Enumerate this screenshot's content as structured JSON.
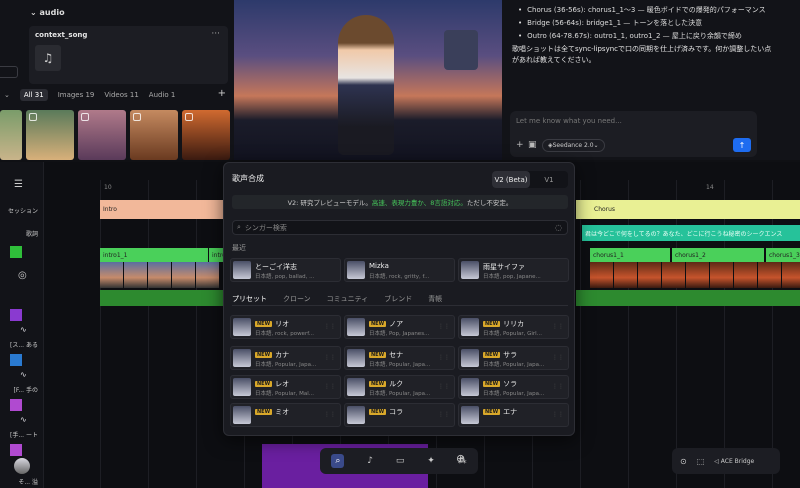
{
  "media_panel": {
    "section": "audio",
    "card_title": "context_song",
    "card_menu": "···",
    "filters": [
      "All 31",
      "Images 19",
      "Videos 11",
      "Audio 1"
    ],
    "add": "+"
  },
  "chat": {
    "bullets": [
      "Chorus (36-56s): chorus1_1〜3 — 暖色ボイドでの爆発的パフォーマンス",
      "Bridge (56-64s): bridge1_1 — トーンを落とした決意",
      "Outro (64-78.67s): outro1_1, outro1_2 — 屋上に戻り余韻で締め"
    ],
    "paragraph": "歌唱ショットは全てsync-lipsyncで口の同期を仕上げ済みです。何か調整したい点があれば教えてください。",
    "placeholder": "Let me know what you need...",
    "model": "Seedance 2.0",
    "send": "↑"
  },
  "timeline": {
    "row_labels": [
      "セッション",
      "歌詞"
    ],
    "section_intro": "Intro",
    "section_chorus": "Chorus",
    "lyric_text": "君は今どこで何をしてるの？あなた、どこに行こうね秘密のシークエンス",
    "clip_labels": [
      "intro1_1",
      "intro1_1",
      "chorus1_1",
      "chorus1_2",
      "chorus1_3"
    ],
    "side_items": [
      "[ス... ある",
      "[F... 手の",
      "[手... ート",
      "そ... 溢"
    ],
    "ruler_ticks": [
      "10",
      "14"
    ]
  },
  "modal": {
    "title": "歌声合成",
    "version_on": "V2 (Beta)",
    "version_off": "V1",
    "banner_pre": "V2: 研究プレビューモデル。",
    "banner_green": "高速、表現力豊か、8言語対応。",
    "banner_post": "ただし不安定。",
    "search_placeholder": "シンガー検索",
    "recent_label": "最近",
    "recent": [
      {
        "name": "とーごイ洋志",
        "tags": "日本語, pop, ballad, ..."
      },
      {
        "name": "Mizka",
        "tags": "日本語, rock, gritty, f..."
      },
      {
        "name": "雨星サイファ",
        "tags": "日本語, pop, Japane..."
      }
    ],
    "tabs": [
      "プリセット",
      "クローン",
      "コミュニティ",
      "ブレンド",
      "青帳"
    ],
    "new_badge": "NEW",
    "presets": [
      {
        "name": "リオ",
        "tags": "日本語, rock, powerf..."
      },
      {
        "name": "ノア",
        "tags": "日本語, Pop, Japanes..."
      },
      {
        "name": "リリカ",
        "tags": "日本語, Popular, Girl..."
      },
      {
        "name": "カナ",
        "tags": "日本語, Popular, Japa..."
      },
      {
        "name": "セナ",
        "tags": "日本語, Popular, Japa..."
      },
      {
        "name": "サラ",
        "tags": "日本語, Popular, Japa..."
      },
      {
        "name": "レオ",
        "tags": "日本語, Popular, Mal..."
      },
      {
        "name": "ルク",
        "tags": "日本語, Popular, Japa..."
      },
      {
        "name": "ソラ",
        "tags": "日本語, Popular, Japa..."
      },
      {
        "name": "ミオ",
        "tags": ""
      },
      {
        "name": "コラ",
        "tags": ""
      },
      {
        "name": "エナ",
        "tags": ""
      }
    ]
  },
  "bottom_right": {
    "label": "ACE Bridge"
  }
}
